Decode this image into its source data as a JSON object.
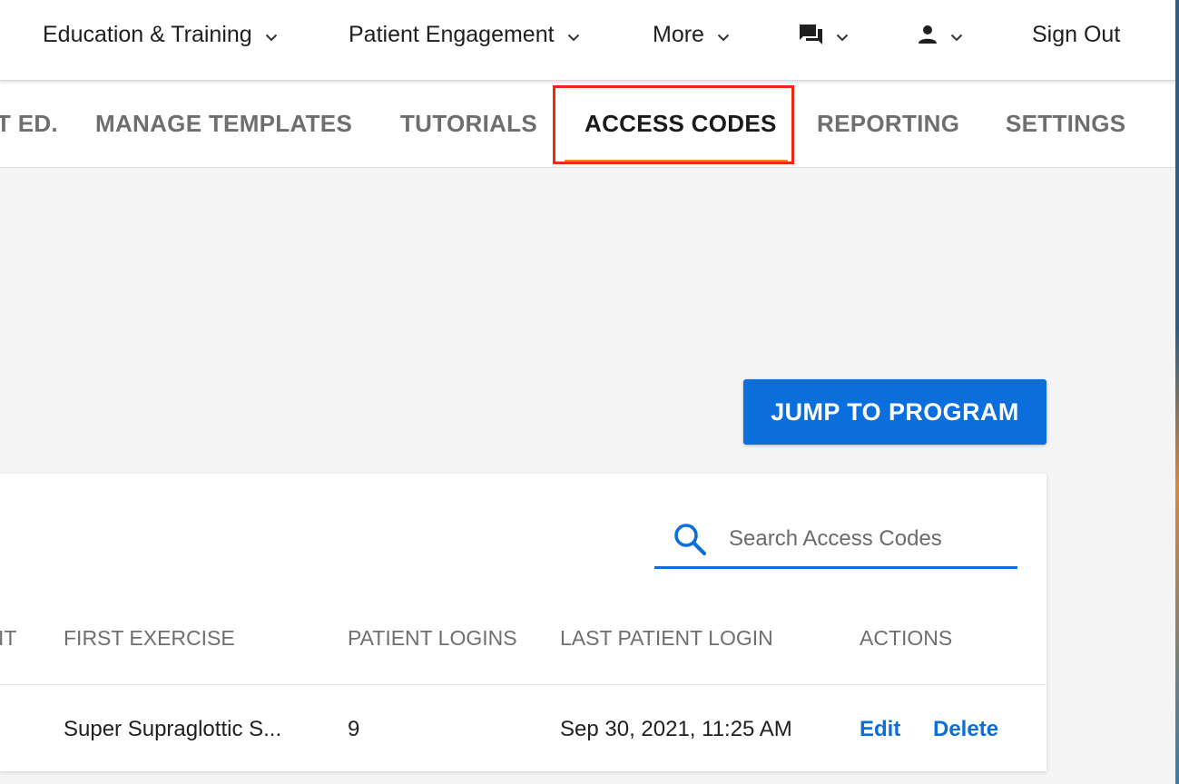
{
  "topnav": {
    "items": [
      {
        "label": "Education & Training"
      },
      {
        "label": "Patient Engagement"
      },
      {
        "label": "More"
      }
    ],
    "sign_out": "Sign Out"
  },
  "tabs": [
    {
      "label": "T ED."
    },
    {
      "label": "MANAGE TEMPLATES"
    },
    {
      "label": "TUTORIALS"
    },
    {
      "label": "ACCESS CODES",
      "active": true
    },
    {
      "label": "REPORTING"
    },
    {
      "label": "SETTINGS"
    }
  ],
  "jump_button": "JUMP TO PROGRAM",
  "search": {
    "placeholder": "Search Access Codes",
    "value": ""
  },
  "table": {
    "headers": [
      "IT",
      "FIRST EXERCISE",
      "PATIENT LOGINS",
      "LAST PATIENT LOGIN",
      "ACTIONS"
    ],
    "rows": [
      {
        "first_exercise": "Super Supraglottic S...",
        "patient_logins": "9",
        "last_patient_login": "Sep 30, 2021, 11:25 AM",
        "edit": "Edit",
        "delete": "Delete"
      }
    ]
  },
  "colors": {
    "accent": "#0a6fdc",
    "highlight_box": "#ec2a10",
    "tab_underline": "#f08a1c"
  },
  "icons": [
    "chevron-down-icon",
    "chat-icon",
    "user-icon",
    "search-icon"
  ]
}
